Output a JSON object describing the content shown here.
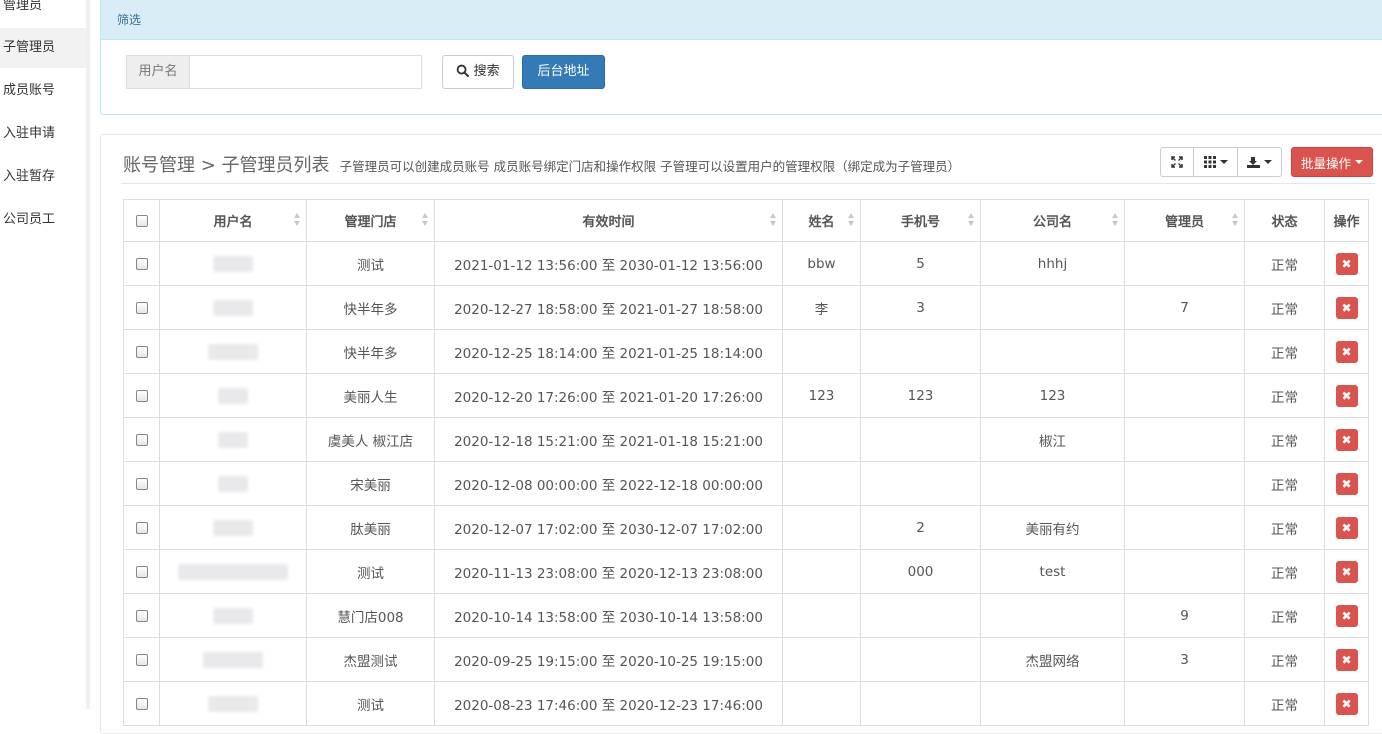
{
  "sidebar": {
    "items": [
      {
        "label": "管理员"
      },
      {
        "label": "子管理员"
      },
      {
        "label": "成员账号"
      },
      {
        "label": "入驻申请"
      },
      {
        "label": "入驻暂存"
      },
      {
        "label": "公司员工"
      }
    ]
  },
  "filter": {
    "heading": "筛选",
    "username_label": "用户名",
    "username_value": "",
    "search_label": "搜索",
    "admin_url_label": "后台地址"
  },
  "main": {
    "title": "账号管理 > 子管理员列表",
    "description": "子管理员可以创建成员账号 成员账号绑定门店和操作权限 子管理可以设置用户的管理权限（绑定成为子管理员）",
    "batch_label": "批量操作"
  },
  "table": {
    "columns": [
      "用户名",
      "管理门店",
      "有效时间",
      "姓名",
      "手机号",
      "公司名",
      "管理员",
      "状态",
      "操作"
    ],
    "rows": [
      {
        "store": "测试",
        "period": "2021-01-12 13:56:00 至 2030-01-12 13:56:00",
        "name": "bbw",
        "phone": "5",
        "company": "hhhj",
        "admin": "",
        "status": "正常"
      },
      {
        "store": "快半年多",
        "period": "2020-12-27 18:58:00 至 2021-01-27 18:58:00",
        "name": "李",
        "phone": "3",
        "company": "",
        "admin": "7",
        "status": "正常"
      },
      {
        "store": "快半年多",
        "period": "2020-12-25 18:14:00 至 2021-01-25 18:14:00",
        "name": "",
        "phone": "",
        "company": "",
        "admin": "",
        "status": "正常"
      },
      {
        "store": "美丽人生",
        "period": "2020-12-20 17:26:00 至 2021-01-20 17:26:00",
        "name": "123",
        "phone": "123",
        "company": "123",
        "admin": "",
        "status": "正常"
      },
      {
        "store": "虞美人 椒江店",
        "period": "2020-12-18 15:21:00 至 2021-01-18 15:21:00",
        "name": "",
        "phone": "",
        "company": "椒江",
        "admin": "",
        "status": "正常"
      },
      {
        "store": "宋美丽",
        "period": "2020-12-08 00:00:00 至 2022-12-18 00:00:00",
        "name": "",
        "phone": "",
        "company": "",
        "admin": "",
        "status": "正常"
      },
      {
        "store": "肽美丽",
        "period": "2020-12-07 17:02:00 至 2030-12-07 17:02:00",
        "name": "",
        "phone": "2",
        "company": "美丽有约",
        "admin": "",
        "status": "正常"
      },
      {
        "store": "测试",
        "period": "2020-11-13 23:08:00 至 2020-12-13 23:08:00",
        "name": "",
        "phone": "000",
        "company": "test",
        "admin": "",
        "status": "正常"
      },
      {
        "store": "慧门店008",
        "period": "2020-10-14 13:58:00 至 2030-10-14 13:58:00",
        "name": "",
        "phone": "",
        "company": "",
        "admin": "9",
        "status": "正常"
      },
      {
        "store": "杰盟测试",
        "period": "2020-09-25 19:15:00 至 2020-10-25 19:15:00",
        "name": "",
        "phone": "",
        "company": "杰盟网络",
        "admin": "3",
        "status": "正常"
      },
      {
        "store": "测试",
        "period": "2020-08-23 17:46:00 至 2020-12-23 17:46:00",
        "name": "",
        "phone": "",
        "company": "",
        "admin": "",
        "status": "正常"
      }
    ]
  },
  "icons": {
    "search": "magnifier-icon",
    "fullscreen": "fullscreen-icon",
    "columns": "grid-icon",
    "export": "export-icon",
    "delete": "close-icon"
  },
  "colors": {
    "primary": "#337ab7",
    "danger": "#d9534f",
    "info_bg": "#d9edf7"
  }
}
